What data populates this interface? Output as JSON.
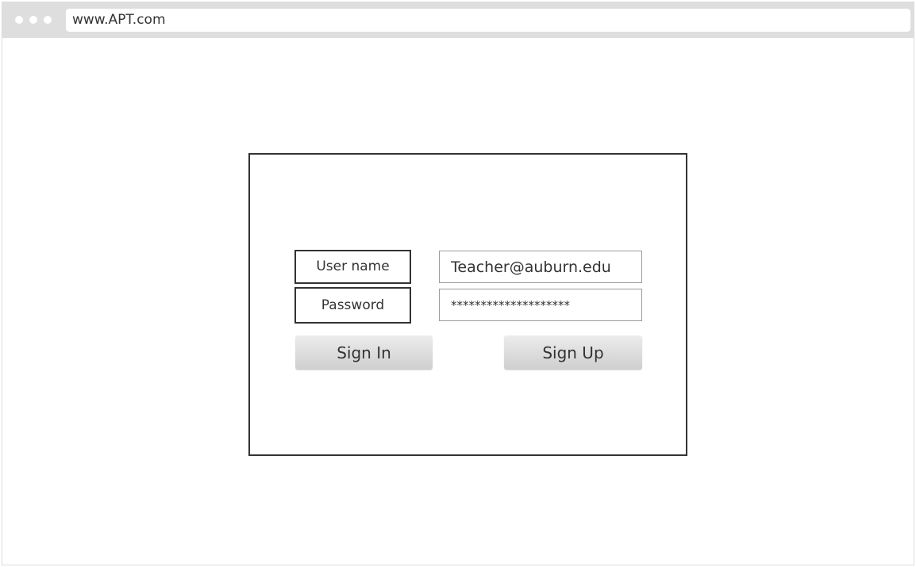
{
  "browser": {
    "url": "www.APT.com"
  },
  "login": {
    "username_label": "User name",
    "password_label": "Password",
    "username_value": "Teacher@auburn.edu",
    "password_value": "********************",
    "sign_in_label": "Sign In",
    "sign_up_label": "Sign Up"
  },
  "colors": {
    "chrome": "#dedede",
    "border": "#333333",
    "button_top": "#ececec",
    "button_bottom": "#cfcfcf"
  }
}
